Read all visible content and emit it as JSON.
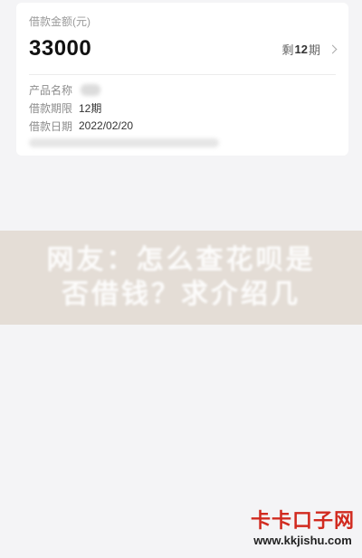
{
  "loan": {
    "amount_label": "借款金额(元)",
    "amount": "33000",
    "remaining_prefix": "剩",
    "remaining_count": "12",
    "remaining_suffix": "期",
    "details": [
      {
        "key": "产品名称",
        "value": ""
      },
      {
        "key": "借款期限",
        "value": "12期"
      },
      {
        "key": "借款日期",
        "value": "2022/02/20"
      }
    ]
  },
  "banner": {
    "line1": "网友：怎么查花呗是",
    "line2": "否借钱？求介绍几"
  },
  "watermark": {
    "logo": "卡卡口子网",
    "url": "www.kkjishu.com"
  }
}
